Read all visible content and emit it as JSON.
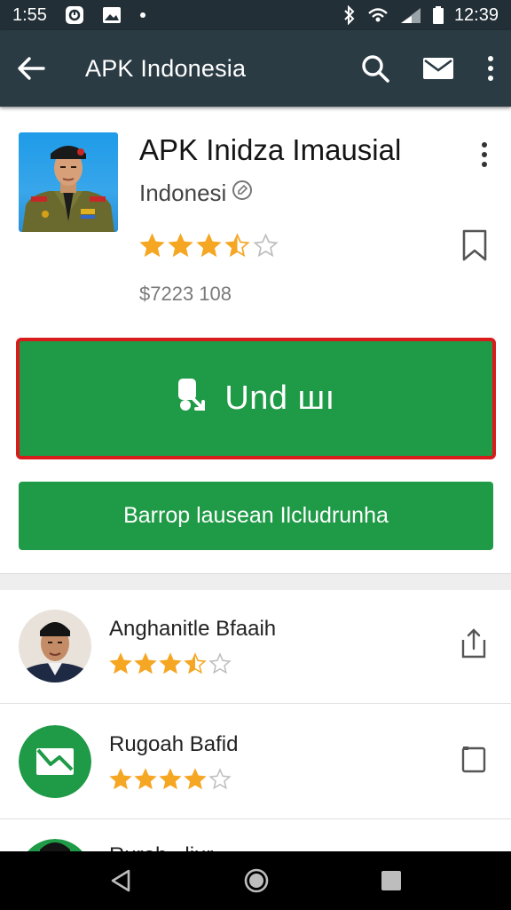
{
  "status_bar": {
    "time_left": "1:55",
    "time_right": "12:39"
  },
  "app_bar": {
    "title": "APK Indonesia",
    "icons": [
      "back-arrow-icon",
      "search-icon",
      "mail-icon",
      "more-vert-icon"
    ]
  },
  "app": {
    "name": "APK Inidza Imausial",
    "developer": "Indonesi",
    "rating": 3.5,
    "price": "$7223 108"
  },
  "buttons": {
    "install_label": "Und шı",
    "secondary_label": "Barrop lausean Ilcludrunha"
  },
  "list": [
    {
      "name": "Anghanitle Bfaaih",
      "rating": 3.5,
      "action_icon": "share-icon"
    },
    {
      "name": "Rugoah Bafid",
      "rating": 4,
      "action_icon": "square-outline-icon"
    },
    {
      "name": "Ruroh...liur"
    }
  ],
  "colors": {
    "toolbar": "#2b3b44",
    "status_bar": "#232f36",
    "primary_button": "#1f9a47",
    "highlight_border": "#d81b1b",
    "star": "#f5a623"
  }
}
